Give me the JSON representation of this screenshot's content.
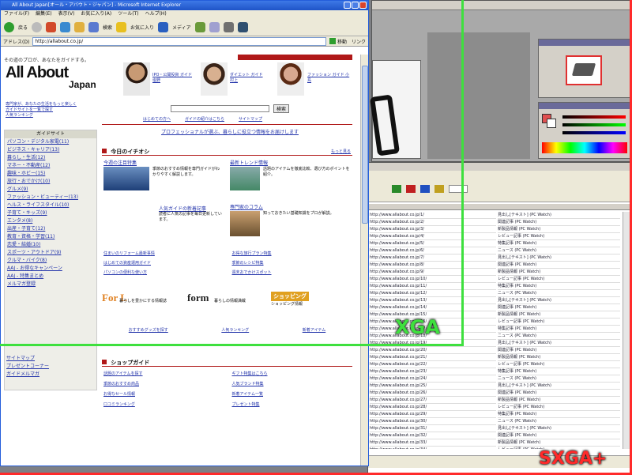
{
  "browser": {
    "title": "All About Japan[オール・アバウト・ジャパン] - Microsoft Internet Explorer",
    "menu": [
      "ファイル(F)",
      "編集(E)",
      "表示(V)",
      "お気に入り(A)",
      "ツール(T)",
      "ヘルプ(H)"
    ],
    "toolbar": {
      "back": "戻る",
      "search": "検索",
      "favorites": "お気に入り",
      "media": "メディア"
    },
    "address_label": "アドレス(D)",
    "address_value": "http://allabout.co.jp/",
    "go_label": "移動",
    "links_label": "リンク"
  },
  "site": {
    "tagline": "その道のプロが、あなたをガイドする。",
    "logo_line1": "All About",
    "logo_line2": "Japan",
    "guides": [
      {
        "caption": "IPO・公開投資 ガイド 塩野"
      },
      {
        "caption": "ダイエット ガイド 村上"
      },
      {
        "caption": "ファッション ガイド 小鳥"
      }
    ],
    "search_button": "検索",
    "top_links": [
      "はじめての方へ",
      "ガイドの紹介はこちら",
      "サイトマップ"
    ],
    "intro_lines": [
      "専門家が、あなたの生活をもっと楽しく",
      "ガイドサイトを一覧で探す",
      "人気ランキング"
    ],
    "sidebar_header": "ガイドサイト",
    "sidebar": [
      "パソコン・デジタル家電(11)",
      "ビジネス・キャリア(13)",
      "暮らし・生活(12)",
      "マネー・不動産(12)",
      "趣味・ホビー(15)",
      "旅行・おでかけ(10)",
      "グルメ(9)",
      "ファッション・ビューティー(13)",
      "ヘルス・ライフスタイル(10)",
      "子育て・キッズ(9)",
      "エンタメ(8)",
      "出産・子育て(12)",
      "教育・資格・学習(11)",
      "恋愛・結婚(10)",
      "スポーツ・アウトドア(9)",
      "クルマ・バイク(8)",
      "AAJ - お得なキャンペーン",
      "AAJ - 特集まとめ",
      "メルマガ登録"
    ],
    "sidebar_bottom": [
      "サイトマップ",
      "プレゼントコーナー",
      "ガイドメルマガ"
    ],
    "banner": "プロフェッショナルが選ぶ、暮らしに役立つ情報をお届けします",
    "today_header": "今日のイチオシ",
    "today_more": "もっと見る",
    "articles": [
      {
        "title": "今週の注目特集",
        "body": "季節のおすすめ情報を専門ガイドがわかりやすく解説します。"
      },
      {
        "title": "最新トレンド情報",
        "body": "話題のアイテムを徹底比較、選び方のポイントを紹介。"
      },
      {
        "title": "人気ガイドの新着記事",
        "body": "読者に人気の記事を毎日更新しています。"
      },
      {
        "title": "専門家のコラム",
        "body": "知っておきたい基礎知識をプロが解説。"
      }
    ],
    "headline_links": [
      "住まいのリフォーム最新事情",
      "お得な旅行プラン特集",
      "はじめての資産運用ガイド",
      "季節のレシピ特集",
      "パソコンの便利な使い方",
      "週末おでかけスポット"
    ],
    "bottom_brands": [
      {
        "logo": "For L",
        "text": "暮らしを豊かにする情報誌"
      },
      {
        "logo": "form",
        "text": "暮らしの情報満載"
      },
      {
        "logo": "ショッピング",
        "text": "ショッピング情報"
      }
    ],
    "bottom_links": [
      "おすすめグッズを探す",
      "人気ランキング",
      "新着アイテム"
    ],
    "shop_header": "ショップガイド",
    "shop_links": [
      "話題のアイテムを探す",
      "ギフト特集はこちら",
      "季節のおすすめ商品",
      "人気ブランド特集",
      "お得なセール情報",
      "新着アイテム一覧",
      "口コミランキング",
      "プレゼント特集"
    ]
  },
  "spreadsheet": {
    "rows": [
      "http://www.allabout.co.jp/1/",
      "http://www.allabout.co.jp/2/",
      "http://www.allabout.co.jp/3/",
      "http://www.allabout.co.jp/4/",
      "http://www.allabout.co.jp/5/",
      "http://www.allabout.co.jp/6/",
      "http://www.allabout.co.jp/7/",
      "http://www.allabout.co.jp/8/",
      "http://www.allabout.co.jp/9/",
      "http://www.allabout.co.jp/10/",
      "http://www.allabout.co.jp/11/",
      "http://www.allabout.co.jp/12/",
      "http://www.allabout.co.jp/13/",
      "http://www.allabout.co.jp/14/",
      "http://www.allabout.co.jp/15/",
      "http://www.allabout.co.jp/16/",
      "http://www.allabout.co.jp/17/",
      "http://www.allabout.co.jp/18/",
      "http://www.allabout.co.jp/19/",
      "http://www.allabout.co.jp/20/",
      "http://www.allabout.co.jp/21/",
      "http://www.allabout.co.jp/22/",
      "http://www.allabout.co.jp/23/",
      "http://www.allabout.co.jp/24/",
      "http://www.allabout.co.jp/25/",
      "http://www.allabout.co.jp/26/",
      "http://www.allabout.co.jp/27/",
      "http://www.allabout.co.jp/28/",
      "http://www.allabout.co.jp/29/",
      "http://www.allabout.co.jp/30/",
      "http://www.allabout.co.jp/31/",
      "http://www.allabout.co.jp/32/",
      "http://www.allabout.co.jp/33/",
      "http://www.allabout.co.jp/34/",
      "http://www.allabout.co.jp/35/",
      "http://www.allabout.co.jp/36/"
    ],
    "notes": [
      "見出し[テキスト] (PC Watch)",
      "関連記事 (PC Watch)",
      "新製品情報 (PC Watch)",
      "レビュー記事 (PC Watch)",
      "特集記事 (PC Watch)",
      "ニュース (PC Watch)"
    ]
  },
  "overlays": {
    "xga_label": "XGA",
    "sxga_label": "SXGA+",
    "xga_color": "#3ee03e",
    "sxga_color": "#ff2a2a"
  }
}
